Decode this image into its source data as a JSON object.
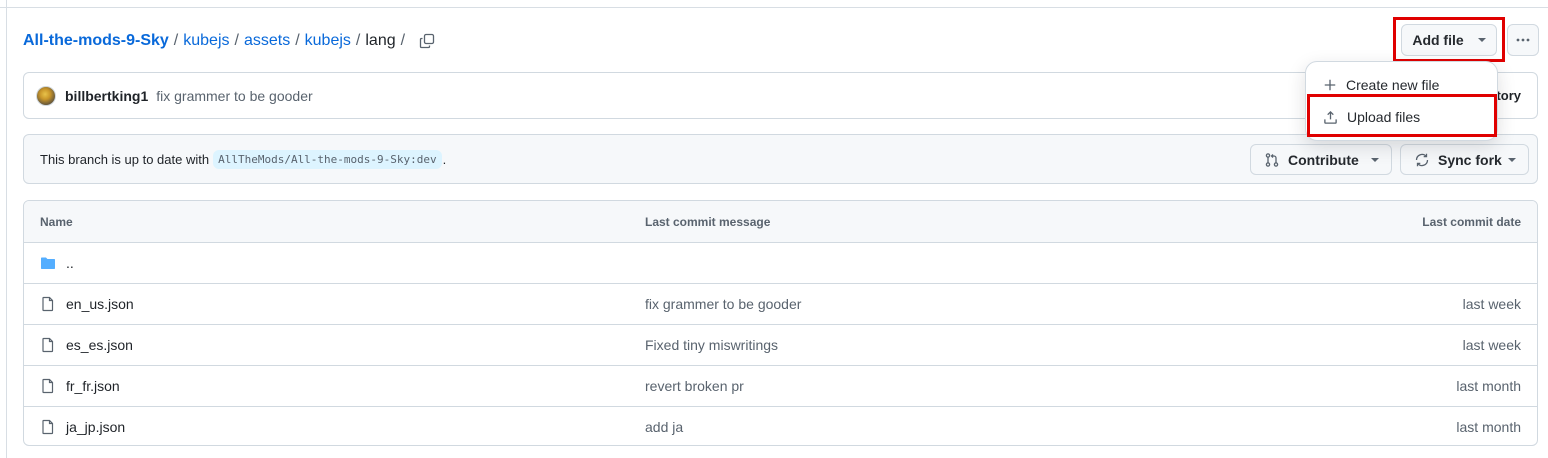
{
  "breadcrumb": {
    "repo": "All-the-mods-9-Sky",
    "segments": [
      "kubejs",
      "assets",
      "kubejs"
    ],
    "current": "lang",
    "separator": "/"
  },
  "actions": {
    "add_file_label": "Add file",
    "more_icon": "kebab-horizontal-icon"
  },
  "add_file_menu": {
    "items": [
      {
        "label": "Create new file",
        "icon": "plus-icon"
      },
      {
        "label": "Upload files",
        "icon": "upload-icon"
      }
    ]
  },
  "commit": {
    "author": "billbertking1",
    "message": "fix grammer to be gooder",
    "history_tail": "tory"
  },
  "branch": {
    "status_text": "This branch is up to date with",
    "upstream": "AllTheMods/All-the-mods-9-Sky:dev",
    "trailing": ".",
    "contribute_label": "Contribute",
    "sync_label": "Sync fork"
  },
  "table": {
    "headers": {
      "name": "Name",
      "message": "Last commit message",
      "date": "Last commit date"
    },
    "parent_dir": "..",
    "rows": [
      {
        "name": "en_us.json",
        "message": "fix grammer to be gooder",
        "date": "last week"
      },
      {
        "name": "es_es.json",
        "message": "Fixed tiny miswritings",
        "date": "last week"
      },
      {
        "name": "fr_fr.json",
        "message": "revert broken pr",
        "date": "last month"
      },
      {
        "name": "ja_jp.json",
        "message": "add ja",
        "date": "last month"
      }
    ]
  },
  "colors": {
    "link": "#0969da",
    "highlight": "#e00000",
    "folder": "#54aeff",
    "muted": "#59636e",
    "border": "#d1d9e0"
  }
}
